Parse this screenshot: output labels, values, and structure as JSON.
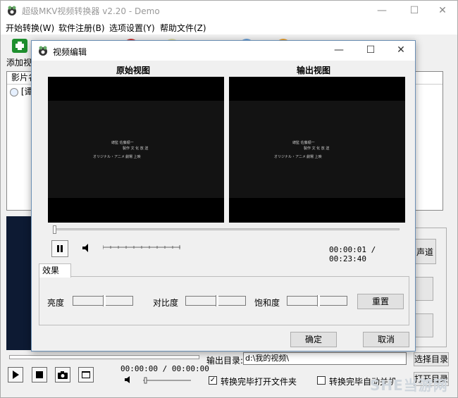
{
  "main": {
    "title": "超级MKV视频转换器 v2.20 - Demo",
    "menu": [
      "开始转换(W)",
      "软件注册(B)",
      "选项设置(Y)",
      "帮助文件(Z)"
    ],
    "toolbar": {
      "add_label": "添加视"
    },
    "filelist": {
      "header": "影片名",
      "row": "[谭"
    },
    "right_buttons": {
      "channel": "声道"
    },
    "time": "00:00:00 / 00:00:00",
    "output_dir_label": "输出目录:",
    "output_dir_value": "d:\\我的视频\\",
    "select_dir": "选择目录",
    "open_dir": "打开目录",
    "open_folder_after": "转换完毕打开文件夹",
    "auto_shutdown": "转换完毕自动关机",
    "watermark": "SHE当游网"
  },
  "dialog": {
    "title": "视频编辑",
    "original_view": "原始视图",
    "output_view": "输出视图",
    "time": "00:00:01 / 00:23:40",
    "effects_tab": "效果",
    "brightness": "亮度",
    "contrast": "对比度",
    "saturation": "饱和度",
    "reset": "重置",
    "ok": "确定",
    "cancel": "取消",
    "caption": {
      "line1": "總監  佐藤順一",
      "line2": "製作  文 化 放 送",
      "line3": "オリジナル・アニメ",
      "line4": "劇場 上映"
    }
  }
}
